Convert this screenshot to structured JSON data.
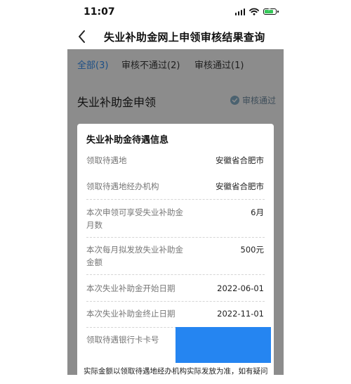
{
  "status_bar": {
    "time": "11:07"
  },
  "nav": {
    "title": "失业补助金网上申领审核结果查询"
  },
  "tabs": [
    {
      "label": "全部(3)"
    },
    {
      "label": "审核不通过(2)"
    },
    {
      "label": "审核通过(1)"
    }
  ],
  "section": {
    "title": "失业补助金申领",
    "status": "审核通过"
  },
  "card": {
    "title": "失业补助金待遇信息",
    "rows": [
      {
        "label": "领取待遇地",
        "value": "安徽省合肥市"
      },
      {
        "label": "领取待遇地经办机构",
        "value": "安徽省合肥市"
      },
      {
        "label": "本次申领可享受失业补助金月数",
        "value": "6月"
      },
      {
        "label": "本次每月拟发放失业补助金金额",
        "value": "500元"
      },
      {
        "label": "本次失业补助金开始日期",
        "value": "2022-06-01"
      },
      {
        "label": "本次失业补助金终止日期",
        "value": "2022-11-01"
      },
      {
        "label": "领取待遇银行卡卡号",
        "value": ""
      }
    ],
    "note": "实际金额以领取待遇地经办机构实际发放为准，如有疑问，请"
  },
  "colors": {
    "accent": "#1c4f86",
    "masked_block": "#2585f1",
    "overlay": "#8c8c8c",
    "battery": "#35c759"
  },
  "status_indicators": {
    "battery_level": 0.85
  }
}
